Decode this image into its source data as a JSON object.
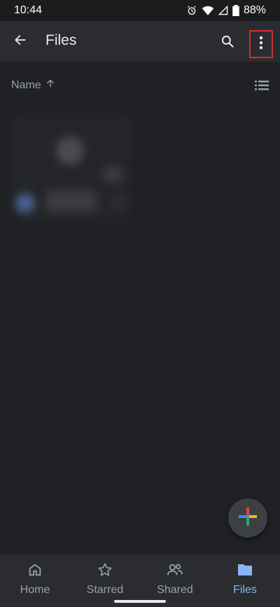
{
  "status_bar": {
    "time": "10:44",
    "battery": "88%",
    "icons": [
      "alarm-icon",
      "wifi-icon",
      "signal-icon",
      "battery-icon"
    ]
  },
  "app_bar": {
    "back_icon": "arrow-back-icon",
    "title": "Files",
    "search_icon": "search-icon",
    "more_icon": "more-vertical-icon",
    "highlight_color": "#d32f2f"
  },
  "sort": {
    "label": "Name",
    "direction_icon": "arrow-up-icon",
    "view_icon": "list-view-icon"
  },
  "fab": {
    "icon": "google-plus-icon"
  },
  "bottom_nav": {
    "items": [
      {
        "label": "Home",
        "icon": "home-icon",
        "active": false
      },
      {
        "label": "Starred",
        "icon": "star-icon",
        "active": false
      },
      {
        "label": "Shared",
        "icon": "shared-icon",
        "active": false
      },
      {
        "label": "Files",
        "icon": "folder-icon",
        "active": true
      }
    ],
    "active_color": "#8ab4f8"
  }
}
